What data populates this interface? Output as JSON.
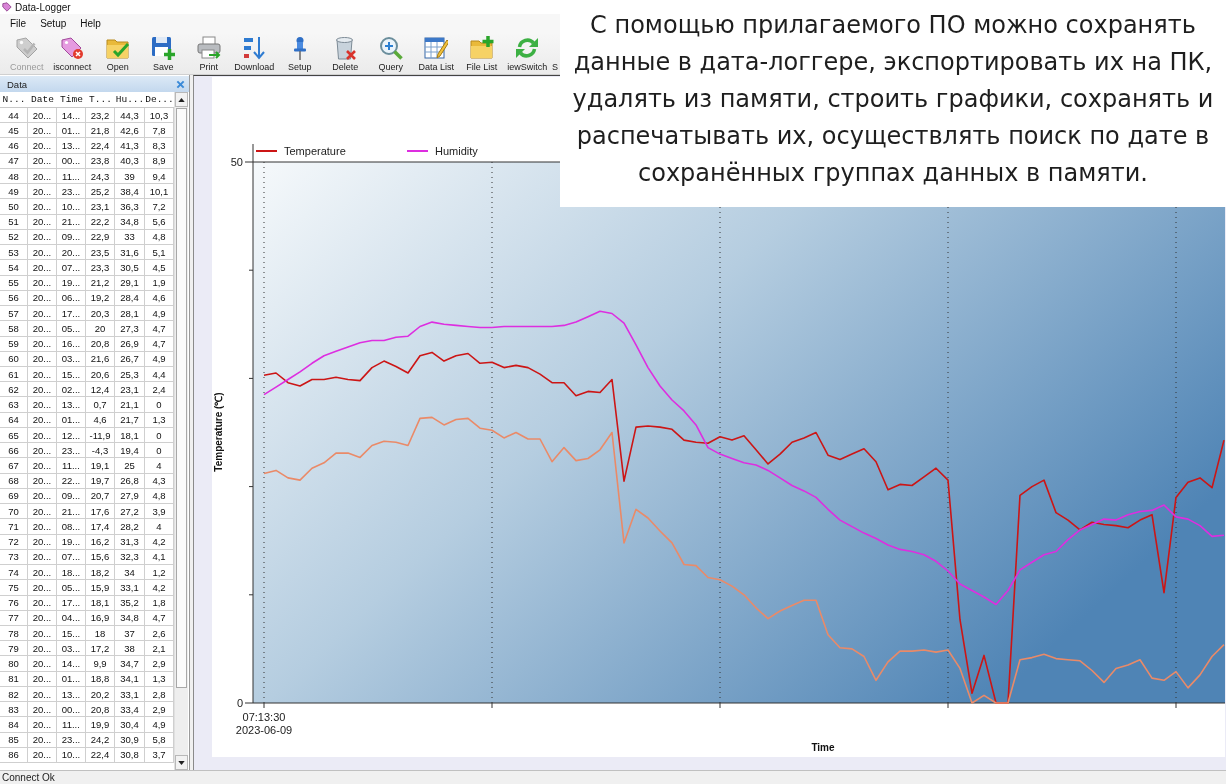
{
  "window": {
    "title": "Data-Logger"
  },
  "menu": [
    "File",
    "Setup",
    "Help"
  ],
  "toolbar": [
    {
      "label": "Connect",
      "disabled": true
    },
    {
      "label": "isconnect",
      "disabled": false
    },
    {
      "label": "Open",
      "disabled": false
    },
    {
      "label": "Save",
      "disabled": false
    },
    {
      "label": "Print",
      "disabled": false
    },
    {
      "label": "Download",
      "disabled": false
    },
    {
      "label": "Setup",
      "disabled": false
    },
    {
      "label": "Delete",
      "disabled": false
    },
    {
      "label": "Query",
      "disabled": false
    },
    {
      "label": "Data List",
      "disabled": false
    },
    {
      "label": "File List",
      "disabled": false
    },
    {
      "label": "iewSwitch",
      "disabled": false
    },
    {
      "label": "S",
      "disabled": false
    }
  ],
  "data_panel": {
    "title": "Data",
    "columns": [
      "N...",
      "Date",
      "Time",
      "T...",
      "Hu...",
      "De..."
    ],
    "rows": [
      [
        "44",
        "20...",
        "14...",
        "23,2",
        "44,3",
        "10,3"
      ],
      [
        "45",
        "20...",
        "01...",
        "21,8",
        "42,6",
        "7,8"
      ],
      [
        "46",
        "20...",
        "13...",
        "22,4",
        "41,3",
        "8,3"
      ],
      [
        "47",
        "20...",
        "00...",
        "23,8",
        "40,3",
        "8,9"
      ],
      [
        "48",
        "20...",
        "11...",
        "24,3",
        "39",
        "9,4"
      ],
      [
        "49",
        "20...",
        "23...",
        "25,2",
        "38,4",
        "10,1"
      ],
      [
        "50",
        "20...",
        "10...",
        "23,1",
        "36,3",
        "7,2"
      ],
      [
        "51",
        "20...",
        "21...",
        "22,2",
        "34,8",
        "5,6"
      ],
      [
        "52",
        "20...",
        "09...",
        "22,9",
        "33",
        "4,8"
      ],
      [
        "53",
        "20...",
        "20...",
        "23,5",
        "31,6",
        "5,1"
      ],
      [
        "54",
        "20...",
        "07...",
        "23,3",
        "30,5",
        "4,5"
      ],
      [
        "55",
        "20...",
        "19...",
        "21,2",
        "29,1",
        "1,9"
      ],
      [
        "56",
        "20...",
        "06...",
        "19,2",
        "28,4",
        "4,6"
      ],
      [
        "57",
        "20...",
        "17...",
        "20,3",
        "28,1",
        "4,9"
      ],
      [
        "58",
        "20...",
        "05...",
        "20",
        "27,3",
        "4,7"
      ],
      [
        "59",
        "20...",
        "16...",
        "20,8",
        "26,9",
        "4,7"
      ],
      [
        "60",
        "20...",
        "03...",
        "21,6",
        "26,7",
        "4,9"
      ],
      [
        "61",
        "20...",
        "15...",
        "20,6",
        "25,3",
        "4,4"
      ],
      [
        "62",
        "20...",
        "02...",
        "12,4",
        "23,1",
        "2,4"
      ],
      [
        "63",
        "20...",
        "13...",
        "0,7",
        "21,1",
        "0"
      ],
      [
        "64",
        "20...",
        "01...",
        "4,6",
        "21,7",
        "1,3"
      ],
      [
        "65",
        "20...",
        "12...",
        "-11,9",
        "18,1",
        "0"
      ],
      [
        "66",
        "20...",
        "23...",
        "-4,3",
        "19,4",
        "0"
      ],
      [
        "67",
        "20...",
        "11...",
        "19,1",
        "25",
        "4"
      ],
      [
        "68",
        "20...",
        "22...",
        "19,7",
        "26,8",
        "4,3"
      ],
      [
        "69",
        "20...",
        "09...",
        "20,7",
        "27,9",
        "4,8"
      ],
      [
        "70",
        "20...",
        "21...",
        "17,6",
        "27,2",
        "3,9"
      ],
      [
        "71",
        "20...",
        "08...",
        "17,4",
        "28,2",
        "4"
      ],
      [
        "72",
        "20...",
        "19...",
        "16,2",
        "31,3",
        "4,2"
      ],
      [
        "73",
        "20...",
        "07...",
        "15,6",
        "32,3",
        "4,1"
      ],
      [
        "74",
        "20...",
        "18...",
        "18,2",
        "34",
        "1,2"
      ],
      [
        "75",
        "20...",
        "05...",
        "15,9",
        "33,1",
        "4,2"
      ],
      [
        "76",
        "20...",
        "17...",
        "18,1",
        "35,2",
        "1,8"
      ],
      [
        "77",
        "20...",
        "04...",
        "16,9",
        "34,8",
        "4,7"
      ],
      [
        "78",
        "20...",
        "15...",
        "18",
        "37",
        "2,6"
      ],
      [
        "79",
        "20...",
        "03...",
        "17,2",
        "38",
        "2,1"
      ],
      [
        "80",
        "20...",
        "14...",
        "9,9",
        "34,7",
        "2,9"
      ],
      [
        "81",
        "20...",
        "01...",
        "18,8",
        "34,1",
        "1,3"
      ],
      [
        "82",
        "20...",
        "13...",
        "20,2",
        "33,1",
        "2,8"
      ],
      [
        "83",
        "20...",
        "00...",
        "20,8",
        "33,4",
        "2,9"
      ],
      [
        "84",
        "20...",
        "11...",
        "19,9",
        "30,4",
        "4,9"
      ],
      [
        "85",
        "20...",
        "23...",
        "24,2",
        "30,9",
        "5,8"
      ],
      [
        "86",
        "20...",
        "10...",
        "22,4",
        "30,8",
        "3,7"
      ]
    ]
  },
  "chart_panel": {
    "chart_data": {
      "type": "line",
      "xlabel": "Time",
      "ylabel": "Temperature (℃)",
      "series": [
        {
          "name": "Temperature",
          "color": "#cc1515",
          "values": [
            30.3,
            30.5,
            29.6,
            29.3,
            29.9,
            29.9,
            30.1,
            29.9,
            29.8,
            31.0,
            31.6,
            31.1,
            30.5,
            32.1,
            32.4,
            31.6,
            32.1,
            32.3,
            31.4,
            31.5,
            31.0,
            31.2,
            31.0,
            30.4,
            29.6,
            29.6,
            28.4,
            28.8,
            28.7,
            29.9,
            20.5,
            25.5,
            25.6,
            25.5,
            25.3,
            24.3,
            24.1,
            24.0,
            24.6,
            24.3,
            24.7,
            23.4,
            22.1,
            23.0,
            24.1,
            24.5,
            25.0,
            22.9,
            22.5,
            23.0,
            23.5,
            22.3,
            19.7,
            20.2,
            20.1,
            20.9,
            21.7,
            20.6,
            7.7,
            0.9,
            4.4,
            0,
            0,
            19.2,
            20.0,
            20.6,
            17.6,
            16.9,
            16.0,
            16.7,
            16.5,
            16.4,
            16.2,
            16.9,
            17.4,
            10.2,
            19.0,
            20.4,
            20.8,
            19.9,
            24.3
          ]
        },
        {
          "name": "Humidity",
          "color": "#dd2ee0",
          "values": [
            28.5,
            29.2,
            29.9,
            30.6,
            31.4,
            32.1,
            32.5,
            32.9,
            33.3,
            33.5,
            33.5,
            33.8,
            33.9,
            34.8,
            35.2,
            35.0,
            34.9,
            34.8,
            34.7,
            34.7,
            34.8,
            34.8,
            34.8,
            34.8,
            34.8,
            34.9,
            35.2,
            35.7,
            36.2,
            36.0,
            35.1,
            33.1,
            31.0,
            29.3,
            28.0,
            27.0,
            25.7,
            23.6,
            23.0,
            22.6,
            22.2,
            22.0,
            21.5,
            20.8,
            20.1,
            19.6,
            19.0,
            17.9,
            16.9,
            16.3,
            15.7,
            15.2,
            14.6,
            14.2,
            14.0,
            13.7,
            13.1,
            12.2,
            11.0,
            10.4,
            9.8,
            9.1,
            10.4,
            12.3,
            13.0,
            13.7,
            14.0,
            15.1,
            16.0,
            16.5,
            17.0,
            16.9,
            17.4,
            17.7,
            17.8,
            18.3,
            17.2,
            17.0,
            16.4,
            15.4,
            15.5
          ]
        },
        {
          "color": "#ea8a68",
          "values": [
            21.2,
            21.5,
            20.8,
            20.6,
            21.7,
            22.2,
            23.1,
            23.1,
            22.7,
            23.8,
            24.2,
            24.1,
            23.8,
            26.3,
            26.4,
            25.7,
            26.2,
            26.3,
            25.4,
            25.2,
            24.5,
            25.0,
            24.4,
            24.4,
            22.3,
            23.6,
            22.4,
            22.6,
            23.4,
            25.0,
            14.8,
            17.9,
            17.1,
            15.9,
            14.8,
            12.8,
            12.7,
            11.6,
            11.4,
            10.8,
            10.0,
            8.8,
            7.8,
            8.5,
            9.0,
            9.5,
            9.5,
            6.3,
            5.1,
            5.0,
            4.3,
            2.1,
            3.8,
            4.8,
            4.8,
            4.9,
            4.7,
            4.9,
            3.2,
            0,
            0.7,
            0,
            0,
            4.0,
            4.2,
            4.5,
            4.1,
            4.0,
            3.9,
            3.0,
            1.9,
            3.2,
            3.5,
            4.0,
            2.3,
            2.1,
            2.9,
            1.4,
            2.6,
            4.3,
            5.4
          ]
        }
      ],
      "ylim": [
        0,
        50
      ],
      "yticks": [
        {
          "value": 0,
          "label": "0"
        },
        {
          "value": 50,
          "label": "50"
        }
      ],
      "grid": true,
      "legend": "top",
      "annotations": [
        {
          "text": "07:13:30 2023-06-09"
        }
      ]
    }
  },
  "status_bar": {
    "text": "Connect Ok"
  },
  "caption": "С помощью прилагаемого ПО можно сохранять данные в дата-логгере, экспортировать их на ПК, удалять из памяти, строить графики, сохранять и распечатывать их, осуществлять поиск по дате в сохранённых группах данных в памяти."
}
